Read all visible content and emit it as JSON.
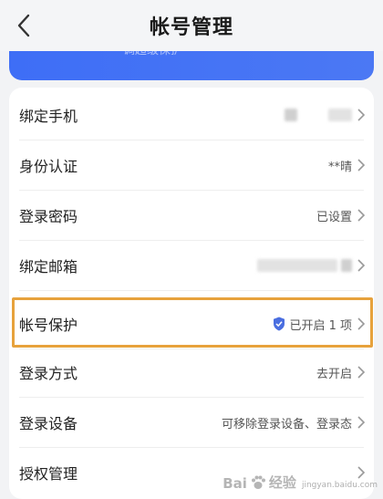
{
  "header": {
    "title": "帐号管理"
  },
  "banner": {
    "text": "调超级保护"
  },
  "rows": [
    {
      "label": "绑定手机",
      "value": ""
    },
    {
      "label": "身份认证",
      "value": "**晴"
    },
    {
      "label": "登录密码",
      "value": "已设置"
    },
    {
      "label": "绑定邮箱",
      "value": ""
    },
    {
      "label": "帐号保护",
      "value": "已开启 1 项"
    },
    {
      "label": "登录方式",
      "value": "去开启"
    },
    {
      "label": "登录设备",
      "value": "可移除登录设备、登录态"
    },
    {
      "label": "授权管理",
      "value": ""
    }
  ],
  "watermark": {
    "brand": "Bai",
    "brand2": "经验",
    "sub": "jingyan.baidu.com"
  },
  "colors": {
    "banner": "#3e6ef6",
    "highlight": "#e7a23c",
    "shield": "#4a6ee0"
  }
}
